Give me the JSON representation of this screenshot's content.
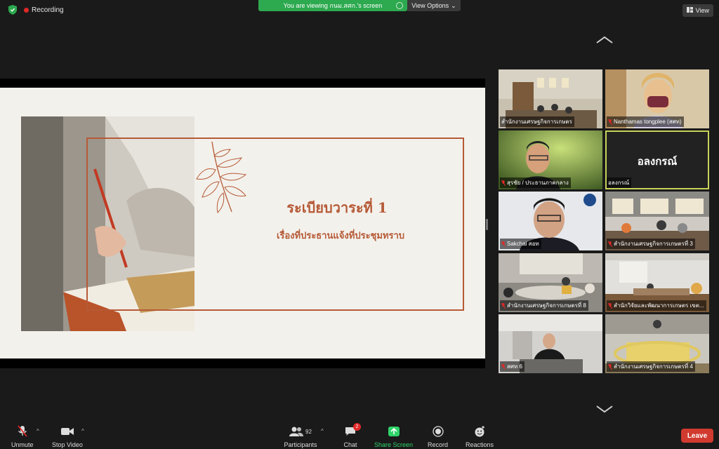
{
  "topbar": {
    "recording_label": "Recording",
    "viewing_banner": "You are viewing กนม.สศก.'s screen",
    "view_options_label": "View Options",
    "view_label": "View"
  },
  "slide": {
    "title": "ระเบียบวาระที่ 1",
    "subtitle": "เรื่องที่ประธานแจ้งที่ประชุมทราบ"
  },
  "participants": [
    {
      "name": "สำนักงานเศรษฐกิจการเกษตร",
      "muted": false
    },
    {
      "name": "Nanthamas tongplee (สศท)",
      "muted": true
    },
    {
      "name": "สุรชัย / ประธานภาคกลาง",
      "muted": true
    },
    {
      "name": "อลงกรณ์",
      "muted": false,
      "display_text": "อลงกรณ์",
      "active": true
    },
    {
      "name": "Sakchai สอท",
      "muted": true
    },
    {
      "name": "สำนักงานเศรษฐกิจการเกษตรที่ 3",
      "muted": true
    },
    {
      "name": "สำนักงานเศรษฐกิจการเกษตรที่ 8",
      "muted": true
    },
    {
      "name": "สำนักวิจัยและพัฒนาการเกษตร เขต...",
      "muted": true
    },
    {
      "name": "สศท 6",
      "muted": true
    },
    {
      "name": "สำนักงานเศรษฐกิจการเกษตรที่ 4",
      "muted": true
    }
  ],
  "toolbar": {
    "unmute": "Unmute",
    "stop_video": "Stop Video",
    "participants_label": "Participants",
    "participants_count": "92",
    "chat_label": "Chat",
    "chat_badge": "2",
    "share_label": "Share Screen",
    "record_label": "Record",
    "reactions_label": "Reactions",
    "leave_label": "Leave"
  },
  "colors": {
    "accent_green": "#2da94f",
    "slide_accent": "#b65a36",
    "leave_red": "#d13a2f",
    "active_speaker": "#c8d35a"
  }
}
